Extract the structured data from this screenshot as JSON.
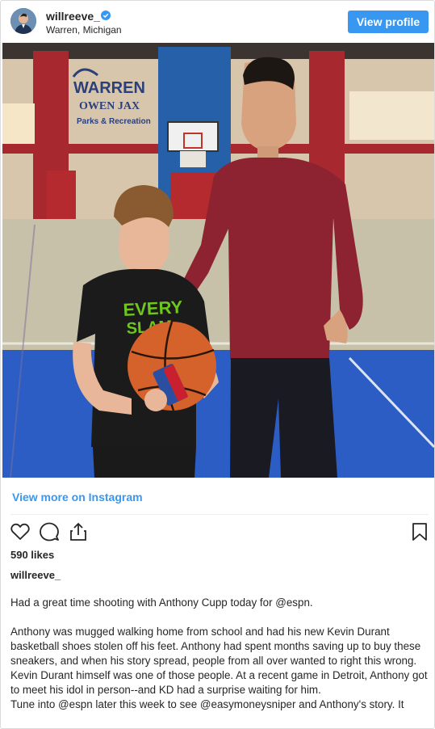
{
  "header": {
    "username": "willreeve_",
    "location": "Warren, Michigan",
    "view_profile_label": "View profile"
  },
  "photo": {
    "sign_line1": "WARREN",
    "sign_line2": "OWEN JAX",
    "sign_line3": "Parks & Recreation",
    "shirt_text1": "EVERY",
    "shirt_text2": "SLAM"
  },
  "view_more_label": "View more on Instagram",
  "likes": "590 likes",
  "caption_user": "willreeve_",
  "caption": {
    "line1": "Had a great time shooting with Anthony Cupp today for @espn.",
    "para2": "Anthony was mugged walking home from school and had his new Kevin Durant basketball shoes stolen off his feet. Anthony had spent months saving up to buy these sneakers, and when his story spread, people from all over wanted to right this wrong.",
    "para3": "Kevin Durant himself was one of those people. At a recent game in Detroit, Anthony got to meet his idol in person--and KD had a surprise waiting for him.",
    "para4": "Tune into @espn later this week to see @easymoneysniper and Anthony's story. It"
  },
  "colors": {
    "accent": "#3897f0",
    "text": "#262626"
  },
  "icons": [
    "verified-badge-icon",
    "heart-icon",
    "comment-icon",
    "share-icon",
    "bookmark-icon"
  ]
}
